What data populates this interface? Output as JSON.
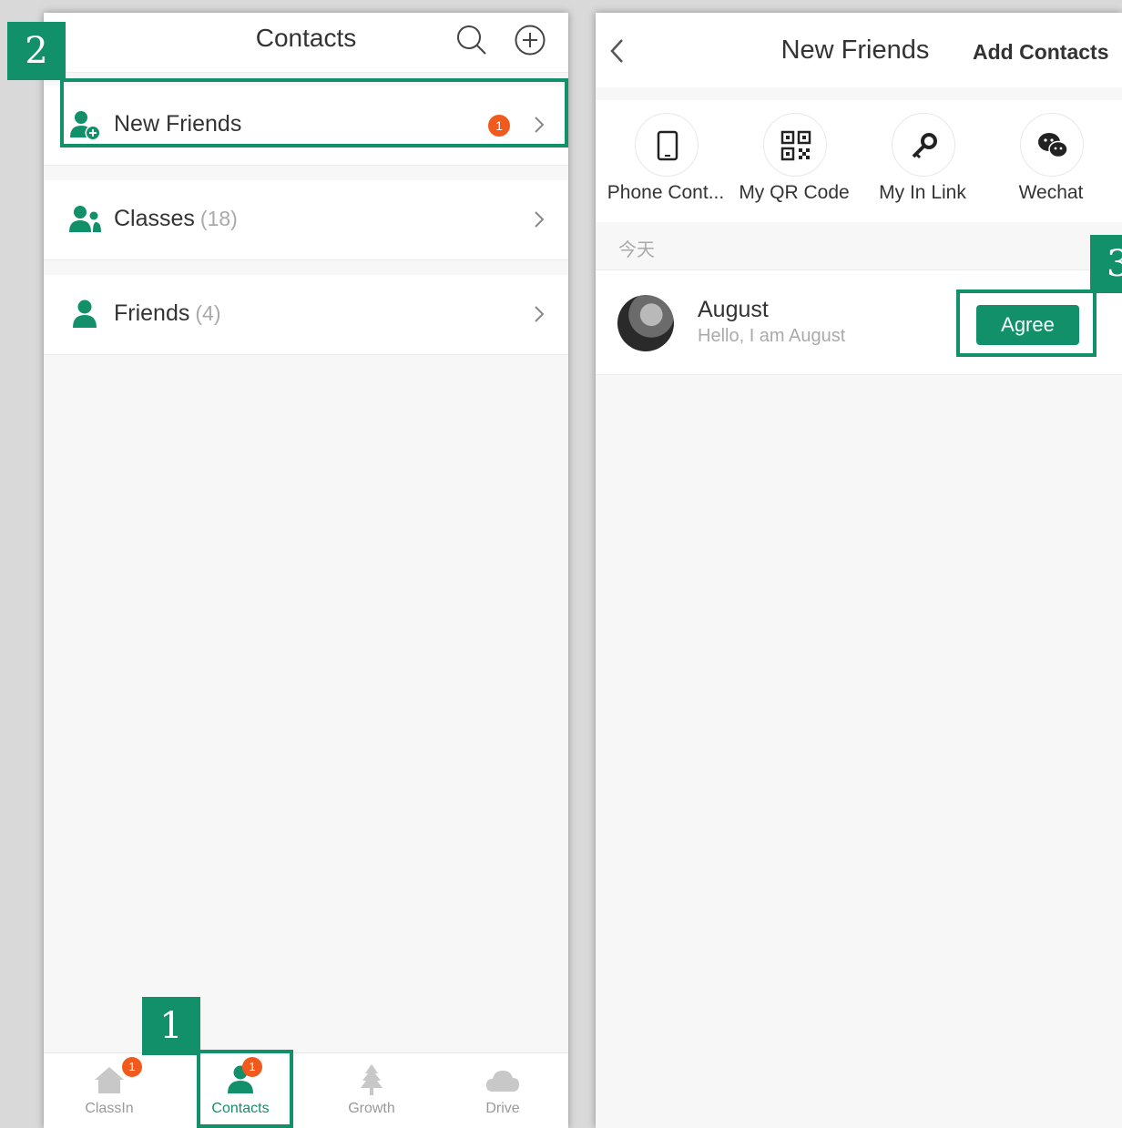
{
  "left": {
    "title": "Contacts",
    "rows": [
      {
        "label": "New Friends",
        "count": "",
        "badge": "1"
      },
      {
        "label": "Classes",
        "count": "(18)"
      },
      {
        "label": "Friends",
        "count": "(4)"
      }
    ],
    "tabs": [
      {
        "label": "ClassIn",
        "badge": "1"
      },
      {
        "label": "Contacts",
        "badge": "1"
      },
      {
        "label": "Growth"
      },
      {
        "label": "Drive"
      }
    ]
  },
  "right": {
    "title": "New Friends",
    "action": "Add Contacts",
    "shortcuts": [
      {
        "label": "Phone Cont..."
      },
      {
        "label": "My QR Code"
      },
      {
        "label": "My In Link"
      },
      {
        "label": "Wechat"
      }
    ],
    "section": "今天",
    "request": {
      "name": "August",
      "message": "Hello, I am August",
      "button": "Agree"
    }
  },
  "steps": [
    "1",
    "2",
    "3"
  ],
  "colors": {
    "accent": "#11906a",
    "badge": "#f25a1d"
  }
}
